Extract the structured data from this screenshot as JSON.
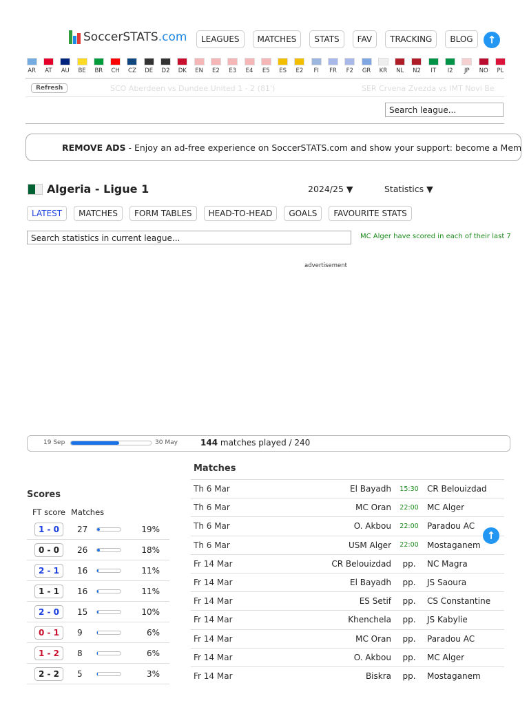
{
  "logo": {
    "soccer": "Soccer",
    "stats": "STATS",
    ".com": ".com"
  },
  "nav": [
    "LEAGUES",
    "MATCHES",
    "STATS",
    "FAV",
    "TRACKING",
    "BLOG"
  ],
  "flags": [
    {
      "c": "AR",
      "col": "#74acdf"
    },
    {
      "c": "AT",
      "col": "#e4002b"
    },
    {
      "c": "AU",
      "col": "#00247d"
    },
    {
      "c": "BE",
      "col": "#fdda24"
    },
    {
      "c": "BR",
      "col": "#009c3b"
    },
    {
      "c": "CH",
      "col": "#ff0000"
    },
    {
      "c": "CZ",
      "col": "#11457e"
    },
    {
      "c": "DE",
      "col": "#333"
    },
    {
      "c": "D2",
      "col": "#333"
    },
    {
      "c": "DK",
      "col": "#c8102e"
    },
    {
      "c": "EN",
      "col": "#f4b6b6"
    },
    {
      "c": "E2",
      "col": "#f4b6b6"
    },
    {
      "c": "E3",
      "col": "#f4b6b6"
    },
    {
      "c": "E4",
      "col": "#f4b6b6"
    },
    {
      "c": "E5",
      "col": "#f4b6b6"
    },
    {
      "c": "ES",
      "col": "#f1bf00"
    },
    {
      "c": "E2",
      "col": "#f1bf00"
    },
    {
      "c": "FI",
      "col": "#9cb6e0"
    },
    {
      "c": "FR",
      "col": "#a8b8e8"
    },
    {
      "c": "F2",
      "col": "#a8b8e8"
    },
    {
      "c": "GR",
      "col": "#7fa6e0"
    },
    {
      "c": "KR",
      "col": "#eee"
    },
    {
      "c": "NL",
      "col": "#ae1c28"
    },
    {
      "c": "N2",
      "col": "#ae1c28"
    },
    {
      "c": "IT",
      "col": "#009246"
    },
    {
      "c": "I2",
      "col": "#009246"
    },
    {
      "c": "JP",
      "col": "#f5d0d0"
    },
    {
      "c": "NO",
      "col": "#ba0c2f"
    },
    {
      "c": "PL",
      "col": "#dc143c"
    }
  ],
  "refresh": "Refresh",
  "ticker": [
    "SCO  Aberdeen vs Dundee United  1 - 2 (81')",
    "SER  Crvena Zvezda vs IMT Novi Be"
  ],
  "search_league": "Search league...",
  "ads": {
    "bold": "REMOVE ADS",
    "text": " - Enjoy an ad-free experience on SoccerSTATS.com and show your support: become a Mem"
  },
  "league": {
    "title": "Algeria - Ligue 1",
    "season": "2024/25 ▼",
    "menu": "Statistics ▼"
  },
  "tabs": [
    "LATEST",
    "MATCHES",
    "FORM TABLES",
    "HEAD-TO-HEAD",
    "GOALS",
    "FAVOURITE STATS"
  ],
  "search_stats": "Search statistics in current league...",
  "fact": "MC Alger have scored in each of their last 7",
  "advertisement": "advertisement",
  "progress": {
    "start": "19 Sep",
    "end": "30 May",
    "played": "144",
    "text": " matches played / 240",
    "fraction": 0.6
  },
  "scores": {
    "title": "Scores",
    "col1": "FT score",
    "col2": "Matches",
    "rows": [
      {
        "s": "1 - 0",
        "n": "27",
        "p": "19%",
        "c": "#1a3ee0"
      },
      {
        "s": "0 - 0",
        "n": "26",
        "p": "18%",
        "c": "#222"
      },
      {
        "s": "2 - 1",
        "n": "16",
        "p": "11%",
        "c": "#1a3ee0"
      },
      {
        "s": "1 - 1",
        "n": "16",
        "p": "11%",
        "c": "#222"
      },
      {
        "s": "2 - 0",
        "n": "15",
        "p": "10%",
        "c": "#1a3ee0"
      },
      {
        "s": "0 - 1",
        "n": "9",
        "p": "6%",
        "c": "#c8102e"
      },
      {
        "s": "1 - 2",
        "n": "8",
        "p": "6%",
        "c": "#c8102e"
      },
      {
        "s": "2 - 2",
        "n": "5",
        "p": "3%",
        "c": "#222"
      }
    ]
  },
  "matches": {
    "title": "Matches",
    "rows": [
      {
        "d": "Th 6 Mar",
        "h": "El Bayadh",
        "t": "15:30",
        "a": "CR Belouizdad"
      },
      {
        "d": "Th 6 Mar",
        "h": "MC Oran",
        "t": "22:00",
        "a": "MC Alger"
      },
      {
        "d": "Th 6 Mar",
        "h": "O. Akbou",
        "t": "22:00",
        "a": "Paradou AC"
      },
      {
        "d": "Th 6 Mar",
        "h": "USM Alger",
        "t": "22:00",
        "a": "Mostaganem"
      },
      {
        "d": "Fr 14 Mar",
        "h": "CR Belouizdad",
        "t": "pp.",
        "a": "NC Magra"
      },
      {
        "d": "Fr 14 Mar",
        "h": "El Bayadh",
        "t": "pp.",
        "a": "JS Saoura"
      },
      {
        "d": "Fr 14 Mar",
        "h": "ES Setif",
        "t": "pp.",
        "a": "CS Constantine"
      },
      {
        "d": "Fr 14 Mar",
        "h": "Khenchela",
        "t": "pp.",
        "a": "JS Kabylie"
      },
      {
        "d": "Fr 14 Mar",
        "h": "MC Oran",
        "t": "pp.",
        "a": "Paradou AC"
      },
      {
        "d": "Fr 14 Mar",
        "h": "O. Akbou",
        "t": "pp.",
        "a": "MC Alger"
      },
      {
        "d": "Fr 14 Mar",
        "h": "Biskra",
        "t": "pp.",
        "a": "Mostaganem"
      }
    ]
  }
}
